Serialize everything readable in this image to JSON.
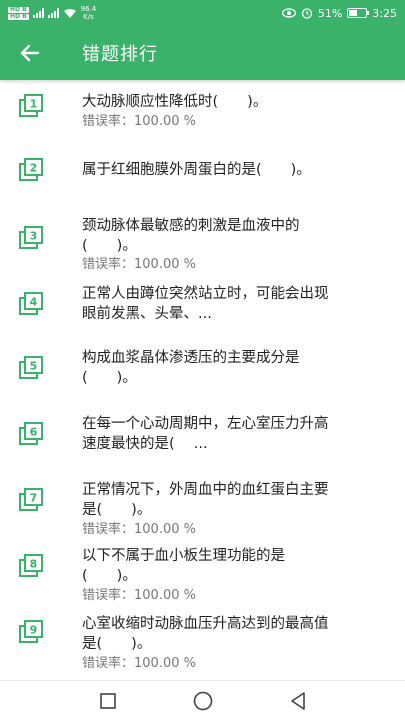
{
  "status_bar": {
    "sim1": "HD B",
    "sim2": "HD B",
    "net_speed_value": "96.4",
    "net_speed_unit": "K/s",
    "battery": "51%",
    "time": "3:25",
    "battery_level": 0.51
  },
  "app_bar": {
    "title": "错题排行"
  },
  "items": [
    {
      "number": "1",
      "line1": "大动脉顺应性降低时(　　)。",
      "line2": "",
      "rate": "错误率：100.00 %"
    },
    {
      "number": "2",
      "line1": "属于红细胞膜外周蛋白的是(　　)。",
      "line2": "",
      "rate": ""
    },
    {
      "number": "3",
      "line1": "颈动脉体最敏感的刺激是血液中的",
      "line2": "(　　)。",
      "rate": "错误率：100.00 %"
    },
    {
      "number": "4",
      "line1": "正常人由蹲位突然站立时，可能会出现",
      "line2": "眼前发黑、头晕、...",
      "rate": ""
    },
    {
      "number": "5",
      "line1": "构成血浆晶体渗透压的主要成分是",
      "line2": "(　　)。",
      "rate": ""
    },
    {
      "number": "6",
      "line1": "在每一个心动周期中，左心室压力升高",
      "line2": "速度最快的是(　 ...",
      "rate": ""
    },
    {
      "number": "7",
      "line1": "正常情况下，外周血中的血红蛋白主要",
      "line2": "是(　　)。",
      "rate": "错误率：100.00 %"
    },
    {
      "number": "8",
      "line1": "以下不属于血小板生理功能的是",
      "line2": "(　　)。",
      "rate": "错误率：100.00 %"
    },
    {
      "number": "9",
      "line1": "心室收缩时动脉血压升高达到的最高值",
      "line2": "是(　　)。",
      "rate": "错误率：100.00 %"
    }
  ],
  "colors": {
    "primary": "#3ab26a",
    "icon": "#3ab26a",
    "text": "#222222",
    "subtext": "#777777"
  }
}
